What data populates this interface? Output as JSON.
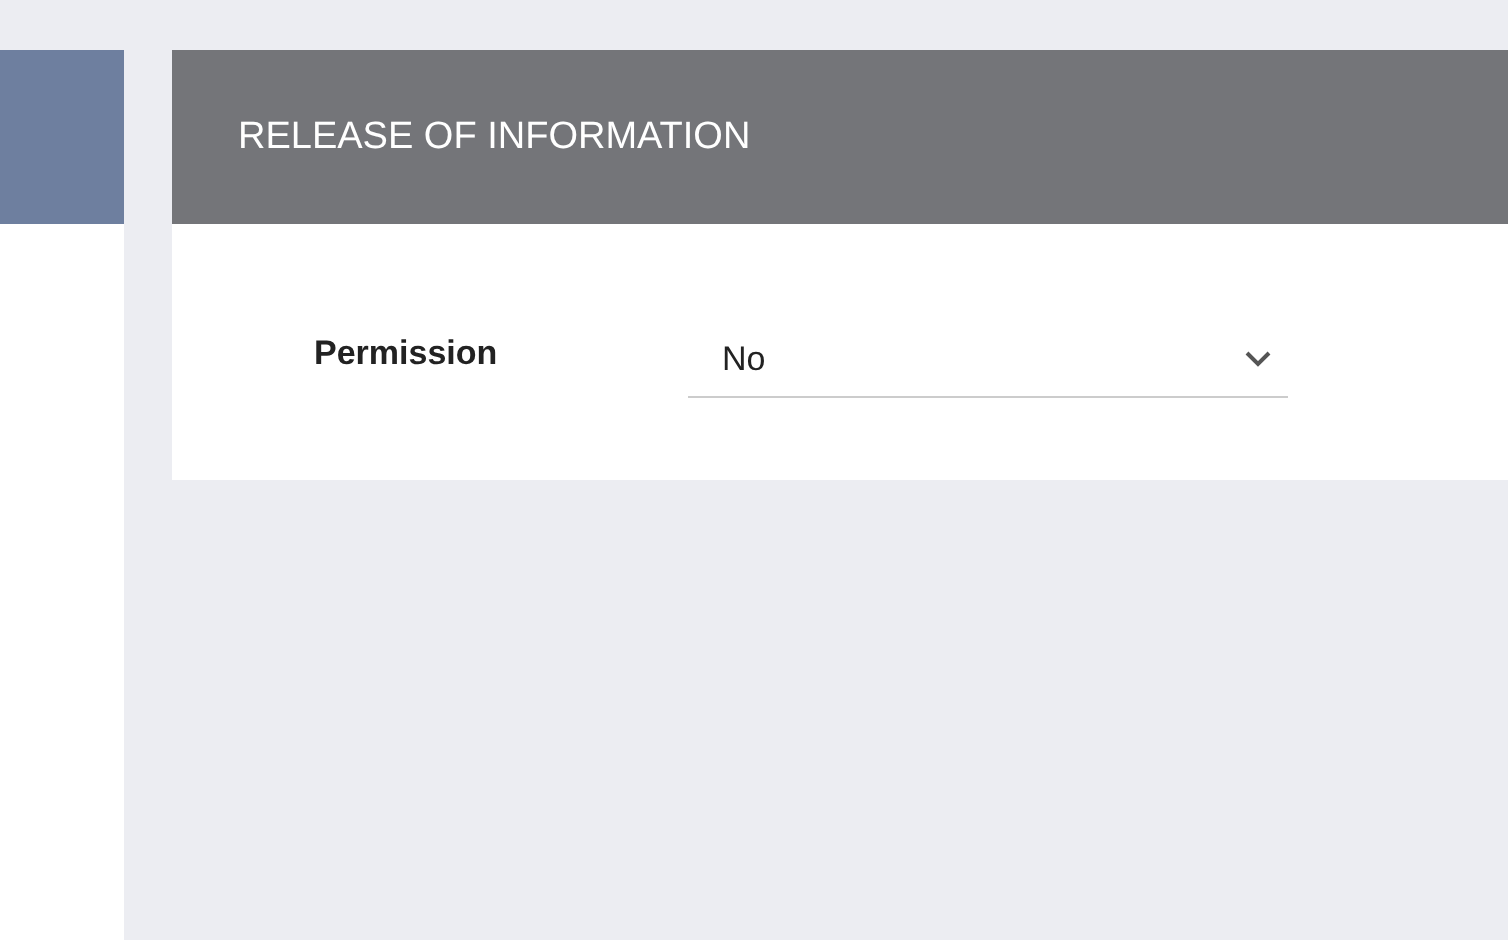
{
  "panel": {
    "title": "RELEASE OF INFORMATION"
  },
  "fields": [
    {
      "label": "Permission",
      "kind": "select",
      "value": "No"
    }
  ]
}
